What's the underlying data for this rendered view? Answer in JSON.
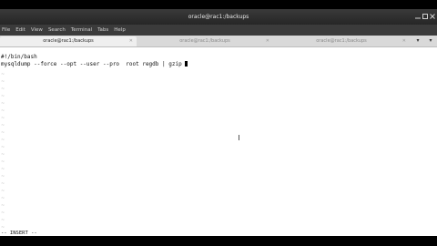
{
  "window": {
    "title": "oracle@rac1:/backups",
    "titlebar_right": "",
    "menu": [
      "File",
      "Edit",
      "View",
      "Search",
      "Terminal",
      "Tabs",
      "Help"
    ],
    "tabs": [
      {
        "label": "oracle@rac1:/backups",
        "active": true
      },
      {
        "label": "oracle@rac1:/backups",
        "active": false
      },
      {
        "label": "oracle@rac1:/backups",
        "active": false
      }
    ]
  },
  "terminal": {
    "line1": "#!/bin/bash",
    "line2": "mysqldump --force --opt --user --pro  root regdb | gzip ",
    "mode": "-- INSERT --"
  }
}
